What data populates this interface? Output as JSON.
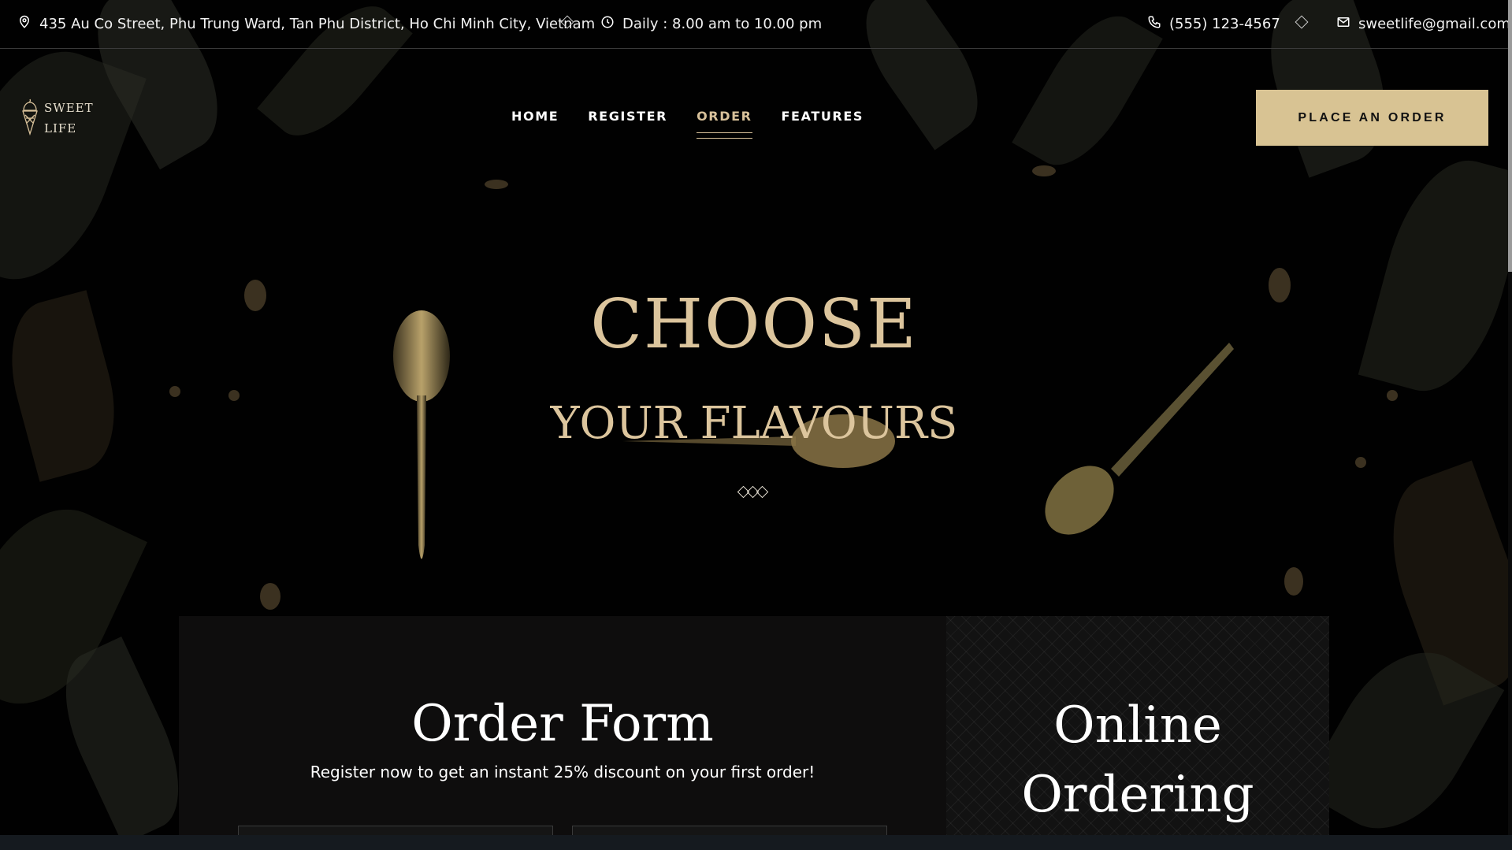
{
  "topbar": {
    "address": "435 Au Co Street, Phu Trung Ward, Tan Phu District, Ho Chi Minh City, Vietnam",
    "hours": "Daily : 8.00 am to 10.00 pm",
    "phone": "(555) 123-4567",
    "email": "sweetlife@gmail.com"
  },
  "logo": {
    "line1": "SWEET",
    "line2": "LIFE"
  },
  "nav": {
    "items": [
      {
        "label": "HOME"
      },
      {
        "label": "REGISTER"
      },
      {
        "label": "ORDER"
      },
      {
        "label": "FEATURES"
      }
    ],
    "active": "ORDER"
  },
  "cta": {
    "label": "PLACE AN ORDER"
  },
  "hero": {
    "title": "CHOOSE",
    "subtitle": "YOUR FLAVOURS"
  },
  "order": {
    "title": "Order Form",
    "subtitle": "Register now to get an instant 25% discount on your first order!"
  },
  "online": {
    "line1": "Online",
    "line2": "Ordering"
  },
  "colors": {
    "accent": "#d8c393",
    "gold_text": "#dcc59d",
    "background": "#010101"
  },
  "icons": {
    "address": "map-pin-icon",
    "hours": "clock-icon",
    "phone": "phone-icon",
    "email": "mail-icon",
    "logo": "ice-cream-cone-icon"
  }
}
